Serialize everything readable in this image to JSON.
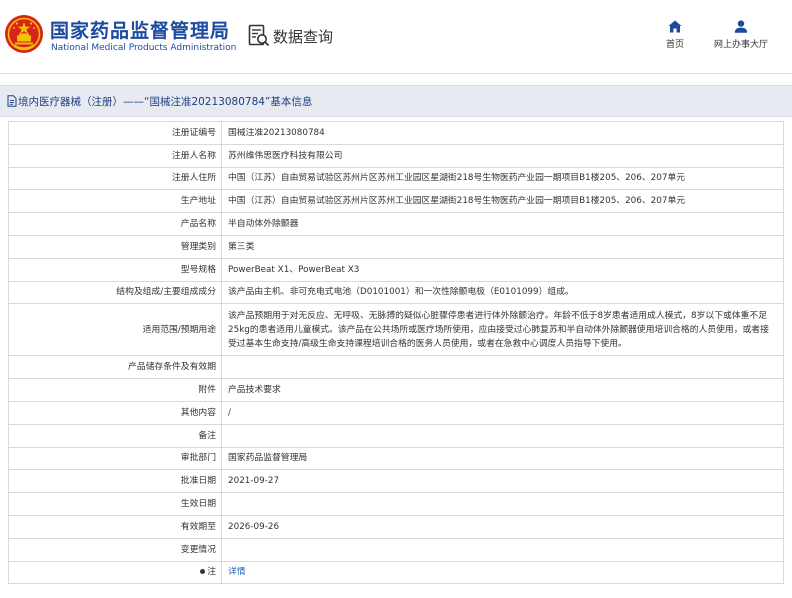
{
  "header": {
    "agency_cn": "国家药品监督管理局",
    "agency_en": "National Medical Products Administration",
    "db_query_label": "数据查询",
    "nav": [
      {
        "label": "首页",
        "icon": "home-icon"
      },
      {
        "label": "网上办事大厅",
        "icon": "user-icon"
      }
    ]
  },
  "colors": {
    "brand_blue": "#1b4a9e",
    "nav_blue": "#1b4a9e",
    "title_bg": "#e7eaf0",
    "link": "#1d5fb8",
    "emblem_red": "#d7231b",
    "emblem_gold": "#f2c200"
  },
  "titlebar": {
    "text": "境内医疗器械（注册）——“国械注准20213080784”基本信息"
  },
  "rows": [
    {
      "label": "注册证编号",
      "value": "国械注准20213080784"
    },
    {
      "label": "注册人名称",
      "value": "苏州维伟思医疗科技有限公司"
    },
    {
      "label": "注册人住所",
      "value": "中国（江苏）自由贸易试验区苏州片区苏州工业园区星湖街218号生物医药产业园一期项目B1楼205、206、207单元"
    },
    {
      "label": "生产地址",
      "value": "中国（江苏）自由贸易试验区苏州片区苏州工业园区星湖街218号生物医药产业园一期项目B1楼205、206、207单元"
    },
    {
      "label": "产品名称",
      "value": "半自动体外除颤器"
    },
    {
      "label": "管理类别",
      "value": "第三类"
    },
    {
      "label": "型号规格",
      "value": "PowerBeat X1、PowerBeat X3"
    },
    {
      "label": "结构及组成/主要组成成分",
      "value": "该产品由主机、非可充电式电池（D0101001）和一次性除颤电极（E0101099）组成。"
    },
    {
      "label": "适用范围/预期用途",
      "value": "该产品预期用于对无反应、无呼吸、无脉搏的疑似心脏骤停患者进行体外除颤治疗。年龄不低于8岁患者适用成人模式，8岁以下或体重不足25kg的患者适用儿童模式。该产品在公共场所或医疗场所使用，应由接受过心肺复苏和半自动体外除颤器使用培训合格的人员使用，或者接受过基本生命支持/高级生命支持课程培训合格的医务人员使用，或者在急救中心调度人员指导下使用。"
    },
    {
      "label": "产品储存条件及有效期",
      "value": ""
    },
    {
      "label": "附件",
      "value": "产品技术要求"
    },
    {
      "label": "其他内容",
      "value": "/"
    },
    {
      "label": "备注",
      "value": ""
    },
    {
      "label": "审批部门",
      "value": "国家药品监督管理局"
    },
    {
      "label": "批准日期",
      "value": "2021-09-27"
    },
    {
      "label": "生效日期",
      "value": ""
    },
    {
      "label": "有效期至",
      "value": "2026-09-26"
    },
    {
      "label": "变更情况",
      "value": ""
    },
    {
      "label": "注",
      "value": "详情"
    }
  ]
}
